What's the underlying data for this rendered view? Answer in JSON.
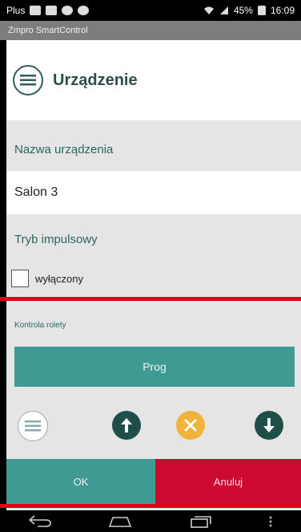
{
  "status_bar": {
    "carrier": "Plus",
    "battery": "45%",
    "time": "16:09"
  },
  "app_title": "Zmpro SmartControl",
  "header": {
    "title": "Urządzenie",
    "icon": "list-icon"
  },
  "fields": {
    "device_name_label": "Nazwa urządzenia",
    "device_name_value": "Salon 3",
    "pulse_mode_label": "Tryb impulsowy",
    "pulse_mode_checkbox_label": "wyłączony",
    "pulse_mode_checked": false
  },
  "roller_control": {
    "section_label": "Kontrola rolety",
    "prog_label": "Prog",
    "icons": [
      "list-icon",
      "arrow-up-icon",
      "stop-icon",
      "arrow-down-icon"
    ]
  },
  "actions": {
    "ok_label": "OK",
    "cancel_label": "Anuluj"
  },
  "colors": {
    "accent_teal": "#3e9a93",
    "dark_teal": "#1f4d48",
    "stop_yellow": "#f2b33d",
    "cancel_red": "#cc0a2f",
    "highlight_red": "#e50019"
  }
}
